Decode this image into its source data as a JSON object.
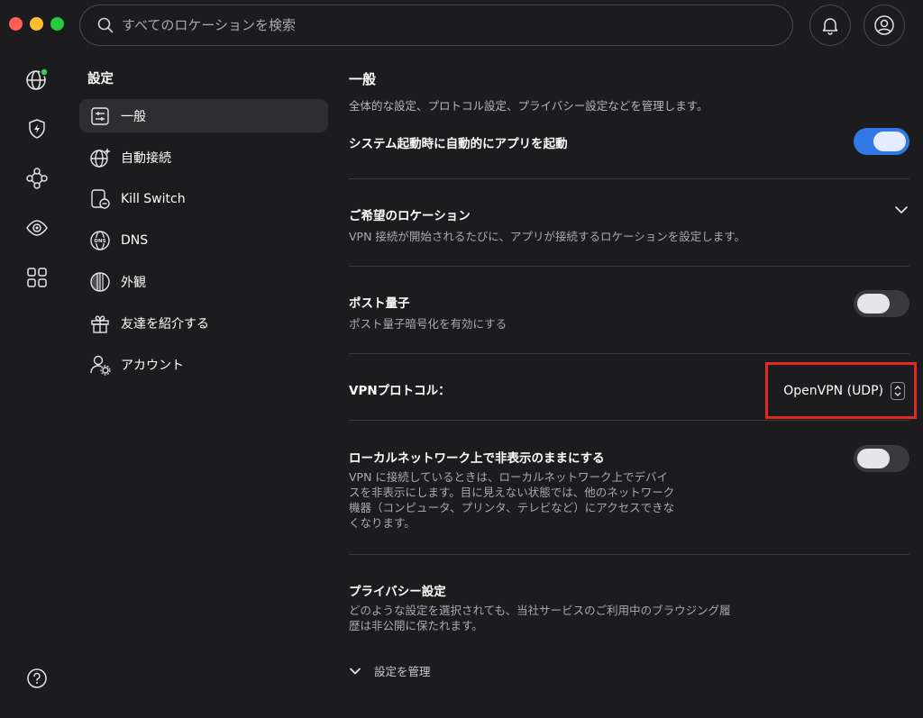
{
  "window": {
    "traffic_lights": {
      "close": "#fe5f57",
      "minimize": "#febc2e",
      "maximize": "#28c840"
    }
  },
  "search": {
    "placeholder": "すべてのロケーションを検索",
    "value": ""
  },
  "header": {
    "bell_icon": "bell-icon",
    "user_icon": "user-circle-icon"
  },
  "rail": {
    "items": [
      {
        "icon": "globe-icon",
        "status_dot": "#30d158"
      },
      {
        "icon": "shield-bolt-icon"
      },
      {
        "icon": "network-nodes-icon"
      },
      {
        "icon": "eye-target-icon"
      },
      {
        "icon": "apps-grid-icon"
      }
    ],
    "help_icon": "help-icon"
  },
  "sidebar": {
    "title": "設定",
    "items": [
      {
        "label": "一般",
        "icon": "sliders-icon",
        "active": true
      },
      {
        "label": "自動接続",
        "icon": "globe-sparkle-icon"
      },
      {
        "label": "Kill Switch",
        "icon": "kill-switch-icon"
      },
      {
        "label": "DNS",
        "icon": "dns-globe-icon"
      },
      {
        "label": "外観",
        "icon": "appearance-icon"
      },
      {
        "label": "友達を紹介する",
        "icon": "gift-icon"
      },
      {
        "label": "アカウント",
        "icon": "account-gear-icon"
      }
    ]
  },
  "main": {
    "title": "一般",
    "description": "全体的な設定、プロトコル設定、プライバシー設定などを管理します。",
    "launch_at_startup": {
      "label": "システム起動時に自動的にアプリを起動",
      "enabled": true
    },
    "preferred_location": {
      "title": "ご希望のロケーション",
      "description": "VPN 接続が開始されるたびに、アプリが接続するロケーションを設定します。"
    },
    "post_quantum": {
      "title": "ポスト量子",
      "description": "ポスト量子暗号化を有効にする",
      "enabled": false
    },
    "vpn_protocol": {
      "label": "VPNプロトコル：",
      "value": "OpenVPN (UDP)"
    },
    "invisible_lan": {
      "title": "ローカルネットワーク上で非表示のままにする",
      "description_lines": [
        "VPN に接続しているときは、ローカルネットワーク上でデバイ",
        "スを非表示にします。目に見えない状態では、他のネットワーク",
        "機器（コンピュータ、プリンタ、テレビなど）にアクセスできな",
        "くなります。"
      ],
      "enabled": false
    },
    "privacy": {
      "title": "プライバシー設定",
      "description_lines": [
        "どのような設定を選択されても、当社サービスのご利用中のブラウジング履",
        "歴は非公開に保たれます。"
      ],
      "manage_label": "設定を管理"
    }
  },
  "colors": {
    "accent": "#3178e6",
    "highlight_box": "#e12a1f",
    "background": "#1c1c1e"
  }
}
